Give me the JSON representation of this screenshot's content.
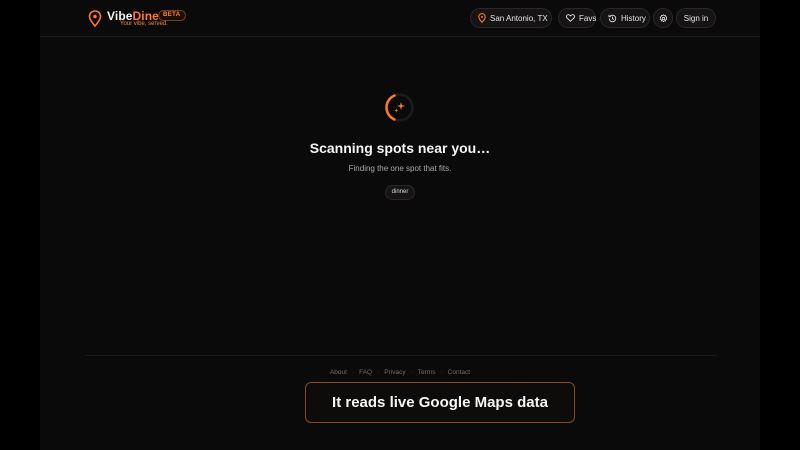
{
  "brand": {
    "name_part1": "Vibe",
    "name_part2": "Dine",
    "badge": "BETA",
    "tagline": "Your vibe, served."
  },
  "nav": {
    "location": "San Antonio, TX",
    "favs": "Favs",
    "history": "History",
    "sign_in": "Sign in"
  },
  "main": {
    "title": "Scanning spots near you…",
    "subtitle": "Finding the one spot that fits.",
    "chip": "dinner"
  },
  "footer": {
    "links": [
      "About",
      "FAQ",
      "Privacy",
      "Terms",
      "Contact"
    ]
  },
  "caption": "It reads live Google Maps data",
  "colors": {
    "accent": "#ff7a2a",
    "background": "#0b0a0a"
  },
  "icons": [
    "map-pin-icon",
    "heart-icon",
    "history-icon",
    "gear-icon",
    "sparkle-icon"
  ]
}
